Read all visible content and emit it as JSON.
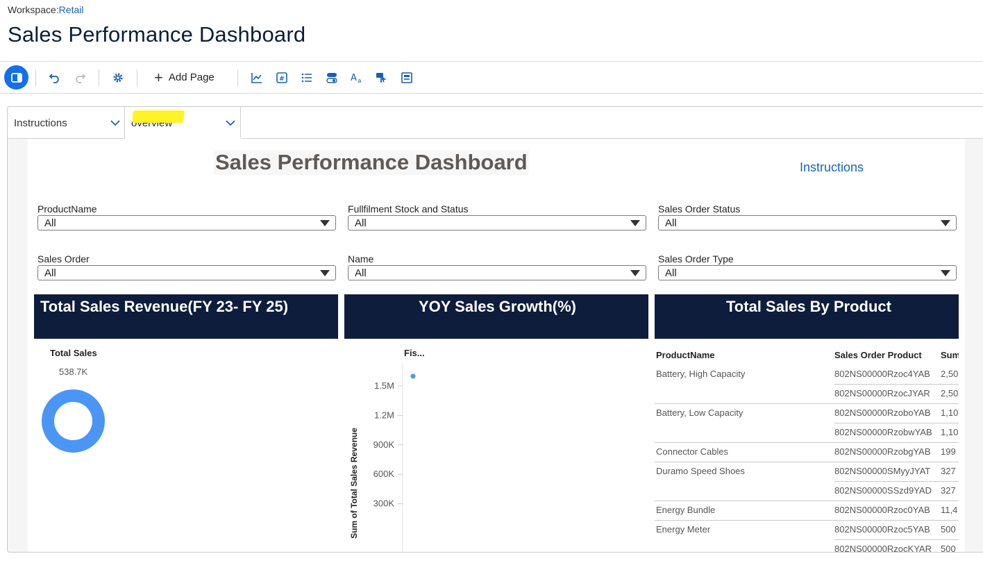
{
  "header": {
    "workspace_label": "Workspace:",
    "workspace_name": "Retail",
    "title": "Sales Performance Dashboard"
  },
  "toolbar": {
    "add_page_label": "Add Page",
    "icons": [
      "panel-toggle-icon",
      "undo-icon",
      "redo-icon",
      "settings-gear-icon",
      "add-icon",
      "line-chart-icon",
      "number-card-icon",
      "list-icon",
      "toggle-icon",
      "text-format-icon",
      "interaction-icon",
      "table-layout-icon"
    ]
  },
  "tabs": [
    {
      "label": "Instructions"
    },
    {
      "label": "overview"
    }
  ],
  "report": {
    "title": "Sales Performance Dashboard",
    "instructions_link": "Instructions",
    "slicers": [
      {
        "label": "ProductName",
        "value": "All"
      },
      {
        "label": "Fullfilment Stock and Status",
        "value": "All"
      },
      {
        "label": "Sales Order Status",
        "value": "All"
      },
      {
        "label": "Sales Order",
        "value": "All"
      },
      {
        "label": "Name",
        "value": "All"
      },
      {
        "label": "Sales Order Type",
        "value": "All"
      }
    ],
    "panels": [
      {
        "title": "Total Sales Revenue(FY 23- FY 25)"
      },
      {
        "title": "YOY Sales Growth(%)"
      },
      {
        "title": "Total Sales By Product"
      }
    ],
    "total_sales": {
      "label": "Total Sales",
      "value": "538.7K"
    },
    "yoy_chart": {
      "legend_title": "Fis...",
      "ylabel": "Sum of Total Sales Revenue",
      "ticks": [
        "1.5M",
        "1.2M",
        "900K",
        "600K",
        "300K"
      ]
    },
    "product_table": {
      "headers": [
        "ProductName",
        "Sales Order Product",
        "Sum"
      ],
      "rows": [
        {
          "product": "Battery, High Capacity",
          "order": "802NS00000Rzoc4YAB",
          "sum": "2,50"
        },
        {
          "product": "",
          "order": "802NS00000RzocJYAR",
          "sum": "2,50"
        },
        {
          "product": "Battery, Low Capacity",
          "order": "802NS00000RzoboYAB",
          "sum": "1,10"
        },
        {
          "product": "",
          "order": "802NS00000RzobwYAB",
          "sum": "1,10"
        },
        {
          "product": "Connector Cables",
          "order": "802NS00000RzobgYAB",
          "sum": "199"
        },
        {
          "product": "Duramo Speed Shoes",
          "order": "802NS00000SMyyJYAT",
          "sum": "327"
        },
        {
          "product": "",
          "order": "802NS00000SSzd9YAD",
          "sum": "327"
        },
        {
          "product": "Energy Bundle",
          "order": "802NS00000Rzoc0YAB",
          "sum": "11,4"
        },
        {
          "product": "Energy Meter",
          "order": "802NS00000Rzoc5YAB",
          "sum": "500"
        },
        {
          "product": "",
          "order": "802NS00000RzocKYAR",
          "sum": "500"
        }
      ]
    }
  },
  "chart_data": {
    "type": "scatter",
    "title": "YOY Sales Growth(%)",
    "ylabel": "Sum of Total Sales Revenue",
    "y_ticks": [
      "1.5M",
      "1.2M",
      "900K",
      "600K",
      "300K"
    ],
    "points": [
      {
        "y": 1600000
      }
    ],
    "series_color": "#4b96f5"
  }
}
